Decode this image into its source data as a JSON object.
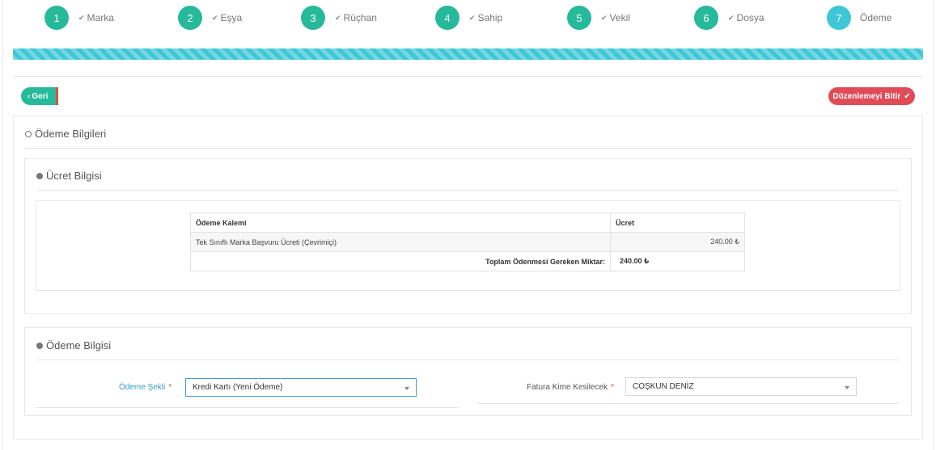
{
  "wizard": {
    "steps": [
      {
        "number": "1",
        "label": "Marka"
      },
      {
        "number": "2",
        "label": "Eşya"
      },
      {
        "number": "3",
        "label": "Rüçhan"
      },
      {
        "number": "4",
        "label": "Sahip"
      },
      {
        "number": "5",
        "label": "Vekil"
      },
      {
        "number": "6",
        "label": "Dosya"
      },
      {
        "number": "7",
        "label": "Ödeme"
      }
    ],
    "active_step": 7,
    "progress_percent": 100,
    "check_icon": "check-icon"
  },
  "actions": {
    "back_label": "Geri",
    "finish_label": "Düzenlemeyi Bitir"
  },
  "payment_info": {
    "title": "Ödeme Bilgileri",
    "fee_section": {
      "title": "Ücret Bilgisi",
      "table": {
        "headers": [
          "Ödeme Kalemi",
          "Ücret"
        ],
        "rows": [
          {
            "item": "Tek Sınıflı Marka Başvuru Ücreti (Çevrimiçi)",
            "fee": "240.00 ₺"
          }
        ],
        "total_label": "Toplam Ödenmesi Gereken Miktar:",
        "total_value": "240.00 ₺"
      }
    },
    "payment_section": {
      "title": "Ödeme Bilgisi",
      "method_label": "Ödeme Şekli",
      "method_value": "Kredi Kartı (Yeni Ödeme)",
      "invoice_label": "Fatura Kime Kesilecek",
      "invoice_value": "COŞKUN DENİZ",
      "required_mark": "*"
    }
  },
  "colors": {
    "step_done": "#26b99a",
    "step_active": "#3ec7d6",
    "finish_button": "#e04b57",
    "label_accent": "#3a9ec2"
  }
}
